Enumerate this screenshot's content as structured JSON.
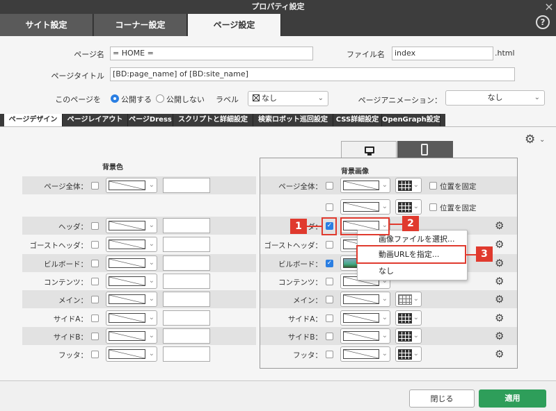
{
  "window": {
    "title": "プロパティ設定",
    "close": "×",
    "help": "?"
  },
  "main_tabs": [
    {
      "label": "サイト設定"
    },
    {
      "label": "コーナー設定"
    },
    {
      "label": "ページ設定"
    }
  ],
  "form": {
    "page_name_label": "ページ名",
    "page_name_value": "= HOME =",
    "file_name_label": "ファイル名",
    "file_name_value": "index",
    "file_ext": ".html",
    "page_title_label": "ページタイトル",
    "page_title_value": "[BD:page_name] of [BD:site_name]",
    "this_page_label": "このページを",
    "publish_label": "公開する",
    "unpublish_label": "公開しない",
    "label_label": "ラベル",
    "label_value": "なし",
    "animation_label": "ページアニメーション：",
    "animation_value": "なし"
  },
  "sub_tabs": [
    {
      "label": "ページデザイン"
    },
    {
      "label": "ページレイアウト"
    },
    {
      "label": "ページDress"
    },
    {
      "label": "スクリプトと詳細設定"
    },
    {
      "label": "検索ロボット巡回設定"
    },
    {
      "label": "CSS詳細設定"
    },
    {
      "label": "OpenGraph設定"
    }
  ],
  "bg_color": {
    "heading": "背景色",
    "rows": [
      {
        "label": "ページ全体："
      },
      {
        "label": "ヘッダ："
      },
      {
        "label": "ゴーストヘッダ："
      },
      {
        "label": "ビルボード："
      },
      {
        "label": "コンテンツ："
      },
      {
        "label": "メイン："
      },
      {
        "label": "サイドA："
      },
      {
        "label": "サイドB："
      },
      {
        "label": "フッタ："
      }
    ]
  },
  "bg_image": {
    "heading": "背景画像",
    "fix_label": "位置を固定",
    "rows": [
      {
        "label": "ページ全体："
      },
      {
        "label": ""
      },
      {
        "label": "ヘッダ："
      },
      {
        "label": "ゴーストヘッダ："
      },
      {
        "label": "ビルボード："
      },
      {
        "label": "コンテンツ："
      },
      {
        "label": "メイン："
      },
      {
        "label": "サイドA："
      },
      {
        "label": "サイドB："
      },
      {
        "label": "フッタ："
      }
    ]
  },
  "popup_menu": [
    {
      "label": "画像ファイルを選択..."
    },
    {
      "label": "動画URLを指定..."
    },
    {
      "label": "なし"
    }
  ],
  "callouts": [
    "1",
    "2",
    "3"
  ],
  "buttons": {
    "close": "閉じる",
    "apply": "適用"
  },
  "colors": {
    "accent": "#2a7ee2",
    "apply": "#2e9e5a",
    "callout": "#e03a2e",
    "dark": "#3d3d3d"
  }
}
